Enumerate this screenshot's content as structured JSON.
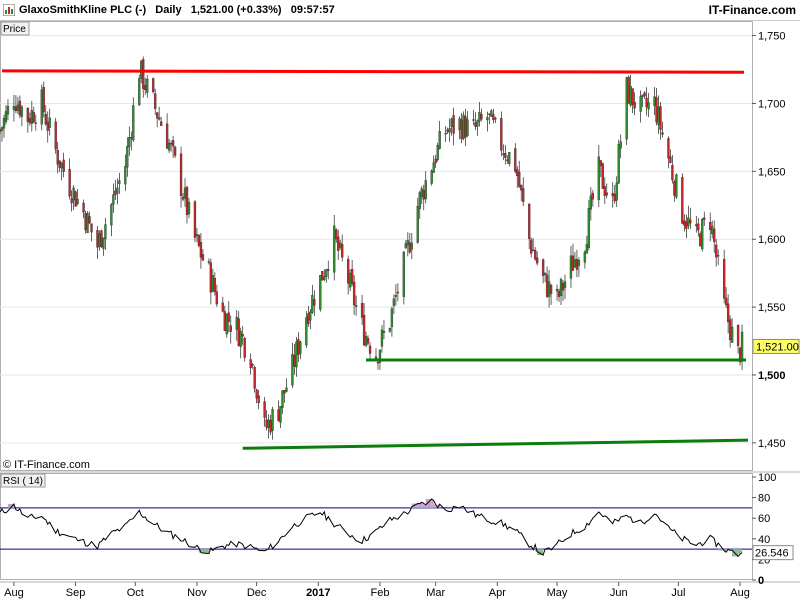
{
  "header": {
    "title": "GlaxoSmithKline PLC (-)   Daily   1,521.00 (+0.33%)   09:57:57",
    "brand": "IT-Finance.com"
  },
  "price_panel": {
    "label": "Price",
    "watermark": "© IT-Finance.com",
    "last_label": "1,521.00"
  },
  "rsi_panel": {
    "label": "RSI ( 14)",
    "last_label": "26.546"
  },
  "colors": {
    "up": "#2e8b2e",
    "down": "#c0282d",
    "resistance": "#ff0000",
    "support": "#0a7d0a",
    "rsi_line": "#000000",
    "rsi_band": "#00008b",
    "rsi_overbought_fill": "#c8a2c8",
    "rsi_oversold_fill": "#8fbc8f"
  },
  "chart_data": [
    {
      "type": "candlestick",
      "title": "GlaxoSmithKline PLC (-) Daily",
      "ylabel": "Price",
      "ylim": [
        1430,
        1760
      ],
      "yticks": [
        1450,
        1500,
        1550,
        1600,
        1650,
        1700,
        1750
      ],
      "ytick_labels": [
        "1,450",
        "1,500",
        "1,550",
        "1,600",
        "1,650",
        "1,700",
        "1,750"
      ],
      "xlim": [
        "2016-07-25",
        "2017-08-07"
      ],
      "xticks": [
        "2016-08-01",
        "2016-09-01",
        "2016-10-01",
        "2016-11-01",
        "2016-12-01",
        "2017-01-01",
        "2017-02-01",
        "2017-03-01",
        "2017-04-01",
        "2017-05-01",
        "2017-06-01",
        "2017-07-01",
        "2017-08-01"
      ],
      "xtick_labels": [
        "Aug",
        "Sep",
        "Oct",
        "Nov",
        "Dec",
        "2017",
        "Feb",
        "Mar",
        "Apr",
        "May",
        "Jun",
        "Jul",
        "Aug"
      ],
      "last_value": 1521.0,
      "series": [
        {
          "approx_close": [
            [
              "2016-07-25",
              1680
            ],
            [
              "2016-08-01",
              1705
            ],
            [
              "2016-08-08",
              1690
            ],
            [
              "2016-08-15",
              1700
            ],
            [
              "2016-08-22",
              1665
            ],
            [
              "2016-08-29",
              1640
            ],
            [
              "2016-09-05",
              1620
            ],
            [
              "2016-09-12",
              1595
            ],
            [
              "2016-09-19",
              1625
            ],
            [
              "2016-09-26",
              1655
            ],
            [
              "2016-10-03",
              1725
            ],
            [
              "2016-10-10",
              1700
            ],
            [
              "2016-10-17",
              1675
            ],
            [
              "2016-10-24",
              1640
            ],
            [
              "2016-10-31",
              1600
            ],
            [
              "2016-11-07",
              1575
            ],
            [
              "2016-11-14",
              1545
            ],
            [
              "2016-11-21",
              1535
            ],
            [
              "2016-11-28",
              1515
            ],
            [
              "2016-12-05",
              1460
            ],
            [
              "2016-12-12",
              1475
            ],
            [
              "2016-12-19",
              1505
            ],
            [
              "2016-12-26",
              1545
            ],
            [
              "2017-01-02",
              1570
            ],
            [
              "2017-01-09",
              1600
            ],
            [
              "2017-01-16",
              1570
            ],
            [
              "2017-01-23",
              1535
            ],
            [
              "2017-01-30",
              1515
            ],
            [
              "2017-02-06",
              1540
            ],
            [
              "2017-02-13",
              1580
            ],
            [
              "2017-02-20",
              1625
            ],
            [
              "2017-02-27",
              1655
            ],
            [
              "2017-03-06",
              1680
            ],
            [
              "2017-03-13",
              1685
            ],
            [
              "2017-03-20",
              1680
            ],
            [
              "2017-03-27",
              1690
            ],
            [
              "2017-04-03",
              1670
            ],
            [
              "2017-04-10",
              1655
            ],
            [
              "2017-04-17",
              1600
            ],
            [
              "2017-04-24",
              1570
            ],
            [
              "2017-05-01",
              1555
            ],
            [
              "2017-05-08",
              1580
            ],
            [
              "2017-05-15",
              1600
            ],
            [
              "2017-05-22",
              1650
            ],
            [
              "2017-05-29",
              1625
            ],
            [
              "2017-06-05",
              1710
            ],
            [
              "2017-06-12",
              1695
            ],
            [
              "2017-06-19",
              1700
            ],
            [
              "2017-06-26",
              1660
            ],
            [
              "2017-07-03",
              1620
            ],
            [
              "2017-07-10",
              1600
            ],
            [
              "2017-07-17",
              1615
            ],
            [
              "2017-07-24",
              1550
            ],
            [
              "2017-07-31",
              1515
            ],
            [
              "2017-08-02",
              1521
            ]
          ]
        }
      ],
      "annotations": [
        {
          "type": "resistance_line",
          "from": [
            "2016-07-26",
            1724
          ],
          "to": [
            "2017-08-03",
            1723
          ]
        },
        {
          "type": "support_line",
          "from": [
            "2017-01-25",
            1511
          ],
          "to": [
            "2017-08-04",
            1511
          ]
        },
        {
          "type": "support_line",
          "from": [
            "2016-11-24",
            1446
          ],
          "to": [
            "2017-08-05",
            1452
          ]
        }
      ]
    },
    {
      "type": "line",
      "title": "RSI ( 14)",
      "ylim": [
        0,
        100
      ],
      "yticks": [
        0,
        20,
        40,
        60,
        80,
        100
      ],
      "ytick_labels": [
        "0",
        "20",
        "40",
        "60",
        "80",
        "100"
      ],
      "bands": [
        30,
        70
      ],
      "last_value": 26.546,
      "series": [
        {
          "name": "RSI ( 14)",
          "points": [
            [
              "2016-07-25",
              65
            ],
            [
              "2016-08-01",
              72
            ],
            [
              "2016-08-08",
              60
            ],
            [
              "2016-08-15",
              62
            ],
            [
              "2016-08-22",
              48
            ],
            [
              "2016-08-29",
              42
            ],
            [
              "2016-09-05",
              37
            ],
            [
              "2016-09-12",
              33
            ],
            [
              "2016-09-19",
              45
            ],
            [
              "2016-09-26",
              52
            ],
            [
              "2016-10-03",
              66
            ],
            [
              "2016-10-10",
              55
            ],
            [
              "2016-10-17",
              46
            ],
            [
              "2016-10-24",
              40
            ],
            [
              "2016-10-31",
              32
            ],
            [
              "2016-11-07",
              27
            ],
            [
              "2016-11-14",
              33
            ],
            [
              "2016-11-21",
              35
            ],
            [
              "2016-11-28",
              32
            ],
            [
              "2016-12-05",
              27
            ],
            [
              "2016-12-12",
              38
            ],
            [
              "2016-12-19",
              52
            ],
            [
              "2016-12-26",
              60
            ],
            [
              "2017-01-02",
              66
            ],
            [
              "2017-01-09",
              55
            ],
            [
              "2017-01-16",
              45
            ],
            [
              "2017-01-23",
              38
            ],
            [
              "2017-01-30",
              47
            ],
            [
              "2017-02-06",
              58
            ],
            [
              "2017-02-13",
              64
            ],
            [
              "2017-02-20",
              72
            ],
            [
              "2017-02-27",
              77
            ],
            [
              "2017-03-06",
              68
            ],
            [
              "2017-03-13",
              72
            ],
            [
              "2017-03-20",
              64
            ],
            [
              "2017-03-27",
              59
            ],
            [
              "2017-04-03",
              55
            ],
            [
              "2017-04-10",
              48
            ],
            [
              "2017-04-17",
              35
            ],
            [
              "2017-04-24",
              26
            ],
            [
              "2017-05-01",
              34
            ],
            [
              "2017-05-08",
              45
            ],
            [
              "2017-05-15",
              52
            ],
            [
              "2017-05-22",
              66
            ],
            [
              "2017-05-29",
              55
            ],
            [
              "2017-06-05",
              62
            ],
            [
              "2017-06-12",
              55
            ],
            [
              "2017-06-19",
              66
            ],
            [
              "2017-06-26",
              50
            ],
            [
              "2017-07-03",
              40
            ],
            [
              "2017-07-10",
              34
            ],
            [
              "2017-07-17",
              40
            ],
            [
              "2017-07-24",
              30
            ],
            [
              "2017-07-31",
              25
            ],
            [
              "2017-08-02",
              26.546
            ]
          ]
        }
      ]
    }
  ]
}
